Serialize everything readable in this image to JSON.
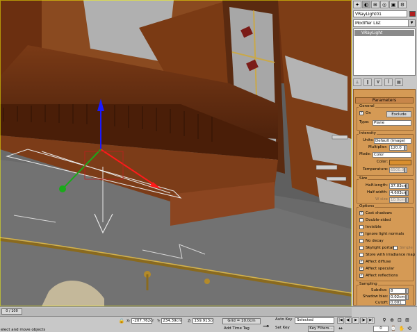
{
  "command_panel": {
    "tabs": [
      "create-icon",
      "modify-icon",
      "hierarchy-icon",
      "motion-icon",
      "display-icon",
      "utilities-icon"
    ],
    "object_name": "VRayLight01",
    "object_color": "#b02020",
    "modifier_list": "Modifier List",
    "stack_item": "VRayLight"
  },
  "rollout": {
    "title": "Parameters",
    "general": {
      "label": "General",
      "on_label": "On",
      "on_checked": "✓",
      "exclude": "Exclude",
      "type_label": "Type:",
      "type_value": "Plane"
    },
    "intensity": {
      "label": "Intensity",
      "units_label": "Units:",
      "units_value": "Default (image)",
      "multiplier_label": "Multiplier:",
      "multiplier_value": "120.0",
      "mode_label": "Mode:",
      "mode_value": "Color",
      "color_label": "Color:",
      "color_value": "#d98f2f",
      "temperature_label": "Temperature:",
      "temperature_value": "6500.0"
    },
    "size": {
      "label": "Size",
      "half_length_label": "Half-length:",
      "half_length_value": "37.83cm",
      "half_width_label": "Half-width:",
      "half_width_value": "4.603cm",
      "w_size_label": "W size",
      "w_size_value": "10.0cm"
    },
    "options": {
      "label": "Options",
      "items": [
        {
          "label": "Cast shadows",
          "mark": "✓"
        },
        {
          "label": "Double-sided",
          "mark": ""
        },
        {
          "label": "Invisible",
          "mark": ""
        },
        {
          "label": "Ignore light normals",
          "mark": "✓"
        },
        {
          "label": "No decay",
          "mark": ""
        },
        {
          "label": "Skylight portal",
          "mark": ""
        },
        {
          "label": "Store with irradiance map",
          "mark": ""
        },
        {
          "label": "Affect diffuse",
          "mark": "✓"
        },
        {
          "label": "Affect specular",
          "mark": "✓"
        },
        {
          "label": "Affect reflections",
          "mark": "✓"
        }
      ],
      "simple_label": "Simple"
    },
    "sampling": {
      "label": "Sampling",
      "subdivs_label": "Subdivs:",
      "subdivs_value": "8",
      "shadow_bias_label": "Shadow bias:",
      "shadow_bias_value": "0.02cm",
      "cutoff_label": "Cutoff:",
      "cutoff_value": "0.001"
    }
  },
  "status": {
    "prompt": "elect and move objects",
    "x_label": "X",
    "x_value": "-207.762cr",
    "y_label": "Y",
    "y_value": "234.39cm",
    "z_label": "Z",
    "z_value": "159.913cr",
    "grid": "Grid = 10.0cm",
    "add_time_tag": "Add Time Tag",
    "auto_key": "Auto Key",
    "set_key": "Set Key",
    "selected": "Selected",
    "key_filters": "Key Filters...",
    "frame": "0",
    "time_slider": "0 / 100"
  }
}
